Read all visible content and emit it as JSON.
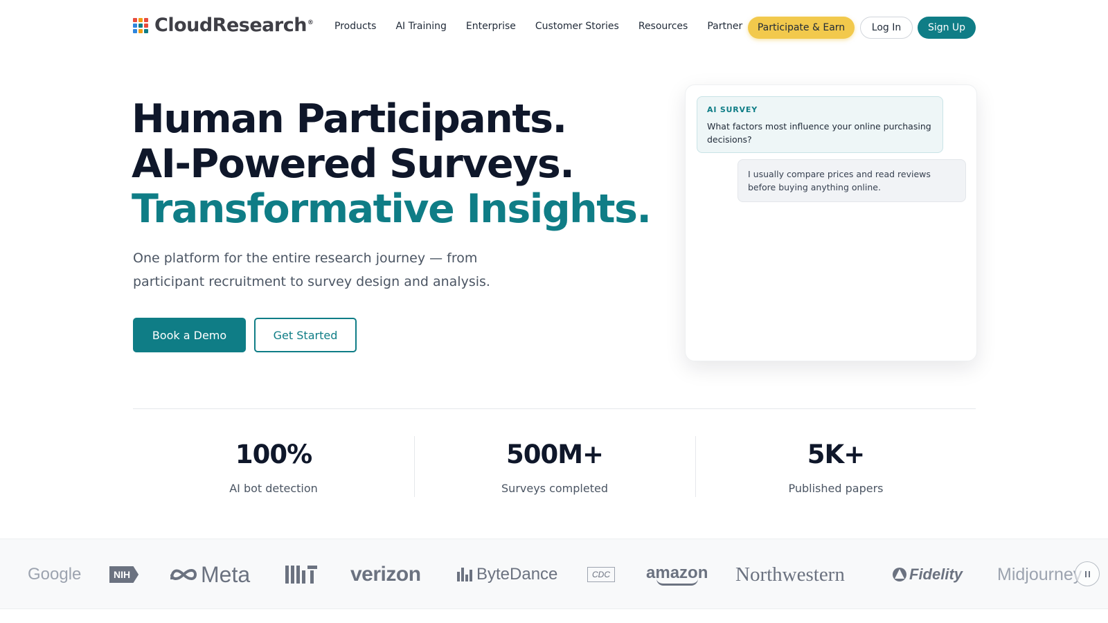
{
  "brand": {
    "name": "CloudResearch",
    "registered": "®",
    "grid_colors": [
      "#e84c3d",
      "#f39c12",
      "#e84c3d",
      "#2e86de",
      "#0f7d86",
      "#e84c3d",
      "#2e86de",
      "#f39c12",
      "#0f7d86"
    ]
  },
  "nav": {
    "links": [
      "Products",
      "AI Training",
      "Enterprise",
      "Customer Stories",
      "Resources",
      "Partner"
    ],
    "earn_label": "Participate & Earn",
    "login_label": "Log In",
    "signup_label": "Sign Up"
  },
  "hero": {
    "line1": "Human Participants.",
    "line2": "AI-Powered Surveys.",
    "line3": "Transformative Insights.",
    "subtitle": "One platform for the entire research journey — from participant recruitment to survey design and analysis.",
    "demo_label": "Book a Demo",
    "start_label": "Get Started"
  },
  "chat": {
    "tag": "AI SURVEY",
    "question": "What factors most influence your online purchasing decisions?",
    "answer": "I usually compare prices and read reviews before buying anything online."
  },
  "stats": [
    {
      "value": "100%",
      "label": "AI bot detection"
    },
    {
      "value": "500M+",
      "label": "Surveys completed"
    },
    {
      "value": "5K+",
      "label": "Published papers"
    }
  ],
  "logos": {
    "google": "Google",
    "nih": "NIH",
    "meta": "Meta",
    "mit": "MIT",
    "verizon": "verizon",
    "bytedance": "ByteDance",
    "cdc": "CDC",
    "amazon": "amazon",
    "northwestern": "Northwestern",
    "fidelity": "Fidelity",
    "midjourney": "Midjourney"
  },
  "colors": {
    "accent": "#0f7d86",
    "earn": "#f2c94c",
    "heading": "#0f172a"
  }
}
